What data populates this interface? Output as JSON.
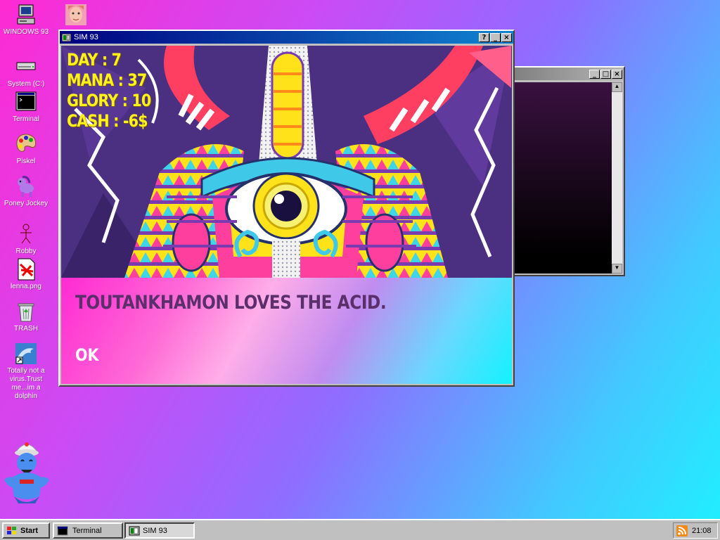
{
  "desktop": {
    "icons": [
      {
        "label": "WINDOWS 93"
      },
      {
        "label": "System (C:)"
      },
      {
        "label": "Terminal"
      },
      {
        "label": "Piskel"
      },
      {
        "label": "Poney Jockey"
      },
      {
        "label": "Robby"
      },
      {
        "label": "lenna.png"
      },
      {
        "label": "TRASH"
      },
      {
        "label": "Totally not a virus.Trust me...im a dolphin"
      }
    ]
  },
  "sim_window": {
    "title": "SIM 93",
    "stats": {
      "day": "DAY : 7",
      "mana": "MANA : 37",
      "glory": "GLORY : 10",
      "cash": "CASH : -6$"
    },
    "message": "TOUTANKHAMON LOVES THE ACID.",
    "ok_label": "OK"
  },
  "taskbar": {
    "start_label": "Start",
    "tasks": [
      {
        "label": "Terminal"
      },
      {
        "label": "SIM 93"
      }
    ],
    "clock": "21:08"
  },
  "colors": {
    "stats_yellow": "#fff21a",
    "message_purple": "#5a2f6c",
    "title_active": "#000080"
  }
}
